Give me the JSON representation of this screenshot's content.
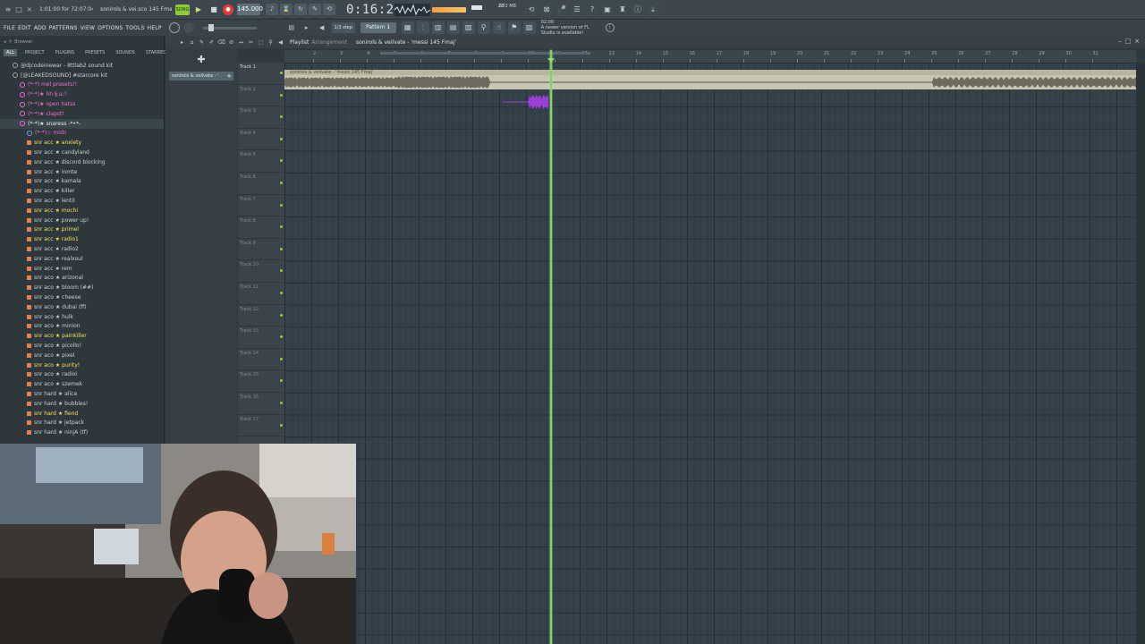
{
  "topbar": {
    "song_info": "1:01:00 for 72:07:04",
    "song_title": "sonirols & vei.sco 145 Fmaj",
    "pat_song": "SONG",
    "bpm": "145.000",
    "time": "0:16:25",
    "cpu_a": "27",
    "cpu_b": "683 MB",
    "cpu_c": "1"
  },
  "menu": {
    "items": [
      "FILE",
      "EDIT",
      "ADD",
      "PATTERNS",
      "VIEW",
      "OPTIONS",
      "TOOLS",
      "HELP"
    ],
    "step": "1/3 step",
    "pattern": "Pattern 1",
    "notice_time": "02:00",
    "notice_text": "A newer version of FL Studio is available!"
  },
  "browser": {
    "title": "Browser",
    "tabs": [
      "ALL",
      "PROJECT",
      "PLUGINS",
      "PRESETS",
      "SOUNDS",
      "STARRED"
    ],
    "items": [
      {
        "label": "@djcodeinewar - 8ttlab2 sound kit",
        "color": "#c9d1d6",
        "type": "folder"
      },
      {
        "label": "[@LEAKEDSOUND] #starcore kit",
        "color": "#c9d1d6",
        "type": "folder"
      },
      {
        "label": "(*ᵕ*) mel presets!!",
        "color": "#f06ed0",
        "type": "pink"
      },
      {
        "label": "(*ᵕ*)★ hh §:a:?",
        "color": "#f06ed0",
        "type": "pink"
      },
      {
        "label": "(*ᵕ*)★ open hatss",
        "color": "#f06ed0",
        "type": "pink"
      },
      {
        "label": "(*ᵕ*)★ clapst!",
        "color": "#f06ed0",
        "type": "pink"
      },
      {
        "label": "(*ᵕ*)★ snaress -*•*-",
        "color": "#e8eef0",
        "type": "pink-sel"
      },
      {
        "label": "(*ᵕ*)☆ midii",
        "color": "#f06ed0",
        "type": "blue"
      },
      {
        "label": "snr acc ★ anxiety",
        "color": "#f3e05a",
        "type": "file"
      },
      {
        "label": "snr acc ★ candyland",
        "color": "#c9d1d6",
        "type": "file"
      },
      {
        "label": "snr acc ★ discord blocking",
        "color": "#c9d1d6",
        "type": "file"
      },
      {
        "label": "snr acc ★ inmte",
        "color": "#c9d1d6",
        "type": "file"
      },
      {
        "label": "snr acc ★ kamala",
        "color": "#c9d1d6",
        "type": "file"
      },
      {
        "label": "snr acc ★ killer",
        "color": "#c9d1d6",
        "type": "file"
      },
      {
        "label": "snr acc ★ lentil",
        "color": "#c9d1d6",
        "type": "file"
      },
      {
        "label": "snr acc ★ mochi",
        "color": "#f3e05a",
        "type": "file"
      },
      {
        "label": "snr acc ★ power up!",
        "color": "#c9d1d6",
        "type": "file"
      },
      {
        "label": "snr acc ★ primel",
        "color": "#f3e05a",
        "type": "file"
      },
      {
        "label": "snr acc ★ radio1",
        "color": "#f3e05a",
        "type": "file"
      },
      {
        "label": "snr acc ★ radio2",
        "color": "#c9d1d6",
        "type": "file"
      },
      {
        "label": "snr acc ★ realxoul",
        "color": "#c9d1d6",
        "type": "file"
      },
      {
        "label": "snr acc ★ rem",
        "color": "#c9d1d6",
        "type": "file"
      },
      {
        "label": "snr aco ★ arizonal",
        "color": "#c9d1d6",
        "type": "file"
      },
      {
        "label": "snr aco ★ bloom (##)",
        "color": "#c9d1d6",
        "type": "file"
      },
      {
        "label": "snr aco ★ cheese",
        "color": "#c9d1d6",
        "type": "file"
      },
      {
        "label": "snr aco ★ dubai (ff)",
        "color": "#c9d1d6",
        "type": "file"
      },
      {
        "label": "snr aco ★ hulk",
        "color": "#c9d1d6",
        "type": "file"
      },
      {
        "label": "snr aco ★ minion",
        "color": "#c9d1d6",
        "type": "file"
      },
      {
        "label": "snr aco ★ painkiller",
        "color": "#f3e05a",
        "type": "file"
      },
      {
        "label": "snr aco ★ picollo!",
        "color": "#c9d1d6",
        "type": "file"
      },
      {
        "label": "snr aco ★ pixel",
        "color": "#c9d1d6",
        "type": "file"
      },
      {
        "label": "snr aco ★ purity!",
        "color": "#f3e05a",
        "type": "file"
      },
      {
        "label": "snr aco ★ radiol",
        "color": "#c9d1d6",
        "type": "file"
      },
      {
        "label": "snr aco ★ szemek",
        "color": "#c9d1d6",
        "type": "file"
      },
      {
        "label": "snr hard ★ alice",
        "color": "#c9d1d6",
        "type": "file"
      },
      {
        "label": "snr hard ★ bubbles!",
        "color": "#c9d1d6",
        "type": "file"
      },
      {
        "label": "snr hard ★ fiend",
        "color": "#f3e05a",
        "type": "file"
      },
      {
        "label": "snr hard ★ jetpack",
        "color": "#c9d1d6",
        "type": "file"
      },
      {
        "label": "snr hard ★ ninjA (tf)",
        "color": "#c9d1d6",
        "type": "file"
      }
    ]
  },
  "picker": {
    "pattern_label": "sonirols & veilvate - '"
  },
  "playlist": {
    "title": "Playlist",
    "arrangement": "Arrangement",
    "song": "sonirols & veilvate - 'messi 145 Fmaj'",
    "clip_label": "sonirols & veilvate - 'messi 145 Fmaj'",
    "ruler": [
      "2",
      "3",
      "4",
      "5",
      "6",
      "7",
      "8",
      "9",
      "10",
      "11",
      "12",
      "13",
      "14",
      "15",
      "16",
      "17",
      "18",
      "19",
      "20",
      "21",
      "22",
      "23",
      "24",
      "25",
      "26",
      "27",
      "28",
      "29",
      "30",
      "31"
    ],
    "tracks": [
      "Track 1",
      "Track 2",
      "Track 3",
      "Track 4",
      "Track 5",
      "Track 6",
      "Track 7",
      "Track 8",
      "Track 9",
      "Track 10",
      "Track 11",
      "Track 12",
      "Track 13",
      "Track 14",
      "Track 15",
      "Track 16",
      "Track 17"
    ]
  },
  "colors": {
    "accent": "#8fcc3a",
    "playhead": "#7fd35f",
    "clip": "#c8c6b2",
    "purple_clip": "#9b3fd6",
    "record": "#e23b3b"
  }
}
